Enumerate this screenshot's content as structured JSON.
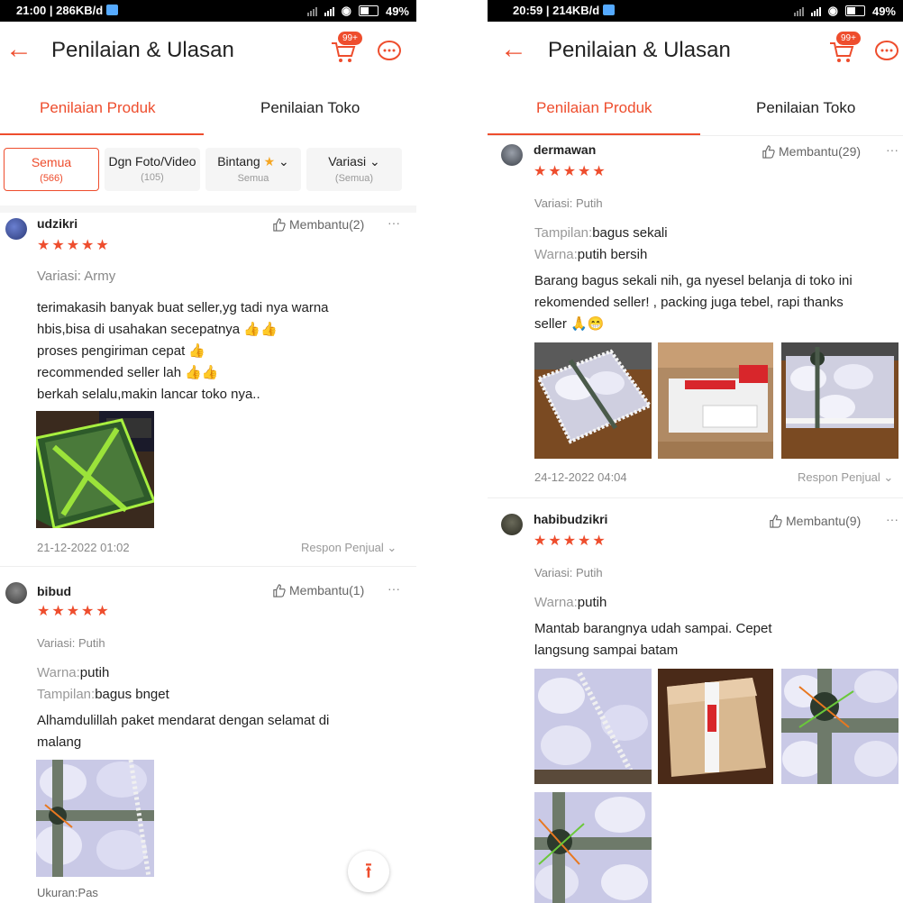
{
  "left": {
    "status": {
      "time": "21:00",
      "speed": "286KB/d",
      "battery": "49%"
    },
    "header": {
      "title": "Penilaian & Ulasan",
      "cart_badge": "99+"
    },
    "tabs": {
      "product": "Penilaian Produk",
      "store": "Penilaian Toko"
    },
    "filters": [
      {
        "label": "Semua",
        "sub": "(566)"
      },
      {
        "label": "Dgn Foto/Video",
        "sub": "(105)"
      },
      {
        "label": "Bintang",
        "sub": "Semua"
      },
      {
        "label": "Variasi",
        "sub": "(Semua)"
      }
    ],
    "reviews": [
      {
        "user": "udzikri",
        "stars": "★★★★★",
        "helpful": "Membantu(2)",
        "variant": "Variasi: Army",
        "body": [
          "terimakasih banyak buat seller,yg tadi nya warna",
          "hbis,bisa di usahakan secepatnya 👍👍",
          "proses pengiriman cepat 👍",
          "recommended seller lah 👍👍",
          "berkah selalu,makin lancar toko nya.."
        ],
        "date": "21-12-2022 01:02",
        "respon": "Respon Penjual"
      },
      {
        "user": "bibud",
        "stars": "★★★★★",
        "helpful": "Membantu(1)",
        "variant": "Variasi: Putih",
        "attr1_key": "Warna:",
        "attr1_val": "putih",
        "attr2_key": "Tampilan:",
        "attr2_val": "bagus bnget",
        "body": [
          "Alhamdulillah paket mendarat dengan selamat di",
          "malang"
        ],
        "extra": "Ukuran:Pas"
      }
    ],
    "totop": "⭱"
  },
  "right": {
    "status": {
      "time": "20:59",
      "speed": "214KB/d",
      "battery": "49%"
    },
    "header": {
      "title": "Penilaian & Ulasan",
      "cart_badge": "99+"
    },
    "tabs": {
      "product": "Penilaian Produk",
      "store": "Penilaian Toko"
    },
    "reviews": [
      {
        "user": "dermawan",
        "stars": "★★★★★",
        "helpful": "Membantu(29)",
        "variant": "Variasi: Putih",
        "attr1_key": "Tampilan:",
        "attr1_val": "bagus sekali",
        "attr2_key": "Warna:",
        "attr2_val": "putih bersih",
        "body": [
          "Barang bagus sekali nih, ga nyesel belanja di toko ini",
          "rekomended seller! , packing juga tebel, rapi thanks",
          "seller 🙏😁"
        ],
        "date": "24-12-2022 04:04",
        "respon": "Respon Penjual"
      },
      {
        "user": "habibudzikri",
        "stars": "★★★★★",
        "helpful": "Membantu(9)",
        "variant": "Variasi: Putih",
        "attr1_key": "Warna:",
        "attr1_val": "putih",
        "body": [
          "Mantab barangnya udah sampai. Cepet",
          "langsung sampai batam"
        ]
      }
    ]
  },
  "colors": {
    "accent": "#ee4d2d",
    "star": "#ee4d2d",
    "muted": "#999999"
  }
}
